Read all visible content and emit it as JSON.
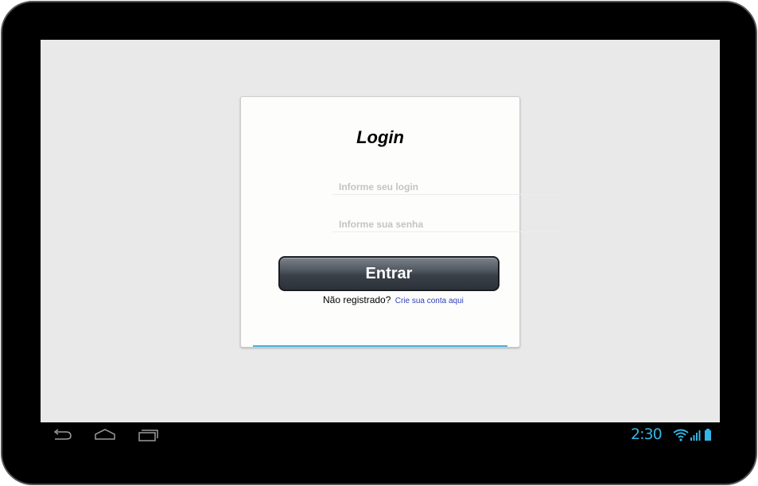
{
  "login_card": {
    "title": "Login",
    "login_placeholder": "Informe seu login",
    "password_placeholder": "Informe sua senha",
    "submit_label": "Entrar",
    "register_prompt": "Não registrado?",
    "register_link": "Crie sua conta aqui"
  },
  "system_bar": {
    "clock": "2:30",
    "icons": [
      "back-icon",
      "home-icon",
      "recent-apps-icon",
      "wifi-icon",
      "signal-icon",
      "battery-icon"
    ]
  },
  "colors": {
    "accent": "#33b5e5",
    "link": "#2f3fbf",
    "button": "#3a4048",
    "screen_background": "#e9e9e9"
  }
}
